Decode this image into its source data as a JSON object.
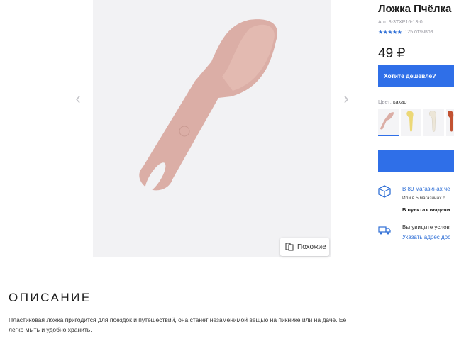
{
  "product": {
    "title": "Ложка Пчёлка",
    "article": "Арт. 3-3ТХР16-13-0",
    "reviews": "125 отзывов",
    "price": "49 ₽",
    "cheaper_button": "Хотите дешевле?",
    "color_label": "Цвет:",
    "color_value": "какао"
  },
  "gallery": {
    "similar_button": "Похожие"
  },
  "availability": {
    "stores_link": "В 89 магазинах че",
    "stores_sub": "Или в 5 магазинах с",
    "pickup": "В пунктах выдачи",
    "delivery_text": "Вы увидите услов",
    "address_link": "Указать адрес дос"
  },
  "description": {
    "heading": "ОПИСАНИЕ",
    "text": "Пластиковая ложка пригодится для поездок и путешествий, она станет незаменимой вещью на пикнике или на даче. Ее легко мыть и удобно хранить."
  },
  "colors": {
    "accent": "#2f6fe8",
    "spoon_cocoa": "#dbaea6",
    "swatch_yellow": "#ecd877",
    "swatch_beige": "#ece6d8",
    "swatch_red": "#c25232"
  }
}
